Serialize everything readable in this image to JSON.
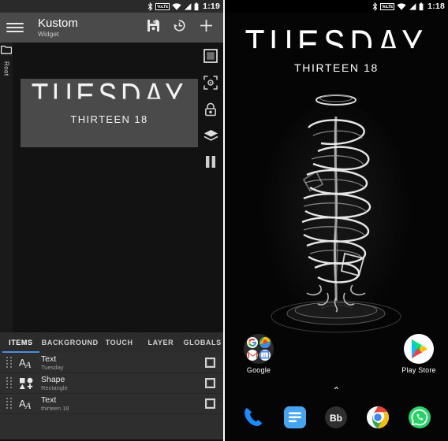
{
  "editor": {
    "statusbar": {
      "bluetooth_icon": "bluetooth-icon",
      "volte_badge": "VoLTE",
      "wifi_icon": "wifi-icon",
      "signal_icon": "signal-icon",
      "battery_icon": "battery-icon",
      "time": "1:19"
    },
    "appbar": {
      "menu_icon": "hamburger-menu-icon",
      "title": "Kustom",
      "subtitle": "Widget",
      "save_icon": "save-icon",
      "history_icon": "history-icon",
      "add_icon": "plus-icon"
    },
    "left_rail": {
      "folder_icon": "folder-icon",
      "label": "Root"
    },
    "right_rail": {
      "items": [
        {
          "name": "preview-square-icon"
        },
        {
          "name": "focus-crop-icon"
        },
        {
          "name": "lock-icon"
        },
        {
          "name": "layers-icon"
        },
        {
          "name": "pause-icon"
        }
      ]
    },
    "preview": {
      "day": "TUESDAY",
      "time_words": "THIRTEEN 18",
      "background_color": "#4a4a4a"
    },
    "tabs": [
      {
        "label": "ITEMS",
        "active": true
      },
      {
        "label": "BACKGROUND",
        "active": false
      },
      {
        "label": "TOUCH",
        "active": false
      },
      {
        "label": "LAYER",
        "active": false
      },
      {
        "label": "GLOBALS",
        "active": false
      }
    ],
    "tab_accent_color": "#4a90d9",
    "items": [
      {
        "icon": "text-item-icon",
        "name": "Text",
        "sub": "Tuesday",
        "checked": false
      },
      {
        "icon": "shape-item-icon",
        "name": "Shape",
        "sub": "Rectangle",
        "checked": false
      },
      {
        "icon": "text-item-icon",
        "name": "Text",
        "sub": "thirteen 18",
        "checked": false
      }
    ]
  },
  "home": {
    "statusbar": {
      "bluetooth_icon": "bluetooth-icon",
      "volte_badge": "VoLTE",
      "wifi_icon": "wifi-icon",
      "signal_icon": "signal-icon",
      "battery_icon": "battery-icon",
      "time": "1:18"
    },
    "widget": {
      "day": "TUESDAY",
      "time_words": "THIRTEEN 18"
    },
    "wallpaper": {
      "description": "abstract-white-wire-sculpture"
    },
    "apps": [
      {
        "name": "google-folder",
        "label": "Google",
        "mini_icons": [
          "google-g-icon",
          "google-maps-icon",
          "gmail-icon",
          "google-calendar-icon"
        ]
      },
      {
        "name": "play-store",
        "label": "Play Store",
        "icon": "play-store-icon"
      }
    ],
    "app_drawer_chevron": "⌃",
    "dock": [
      {
        "name": "phone",
        "icon": "phone-icon"
      },
      {
        "name": "messages",
        "icon": "messages-icon"
      },
      {
        "name": "bb",
        "icon": "bb-icon",
        "label": "Bb"
      },
      {
        "name": "chrome",
        "icon": "chrome-icon"
      },
      {
        "name": "whatsapp",
        "icon": "whatsapp-icon"
      }
    ]
  }
}
